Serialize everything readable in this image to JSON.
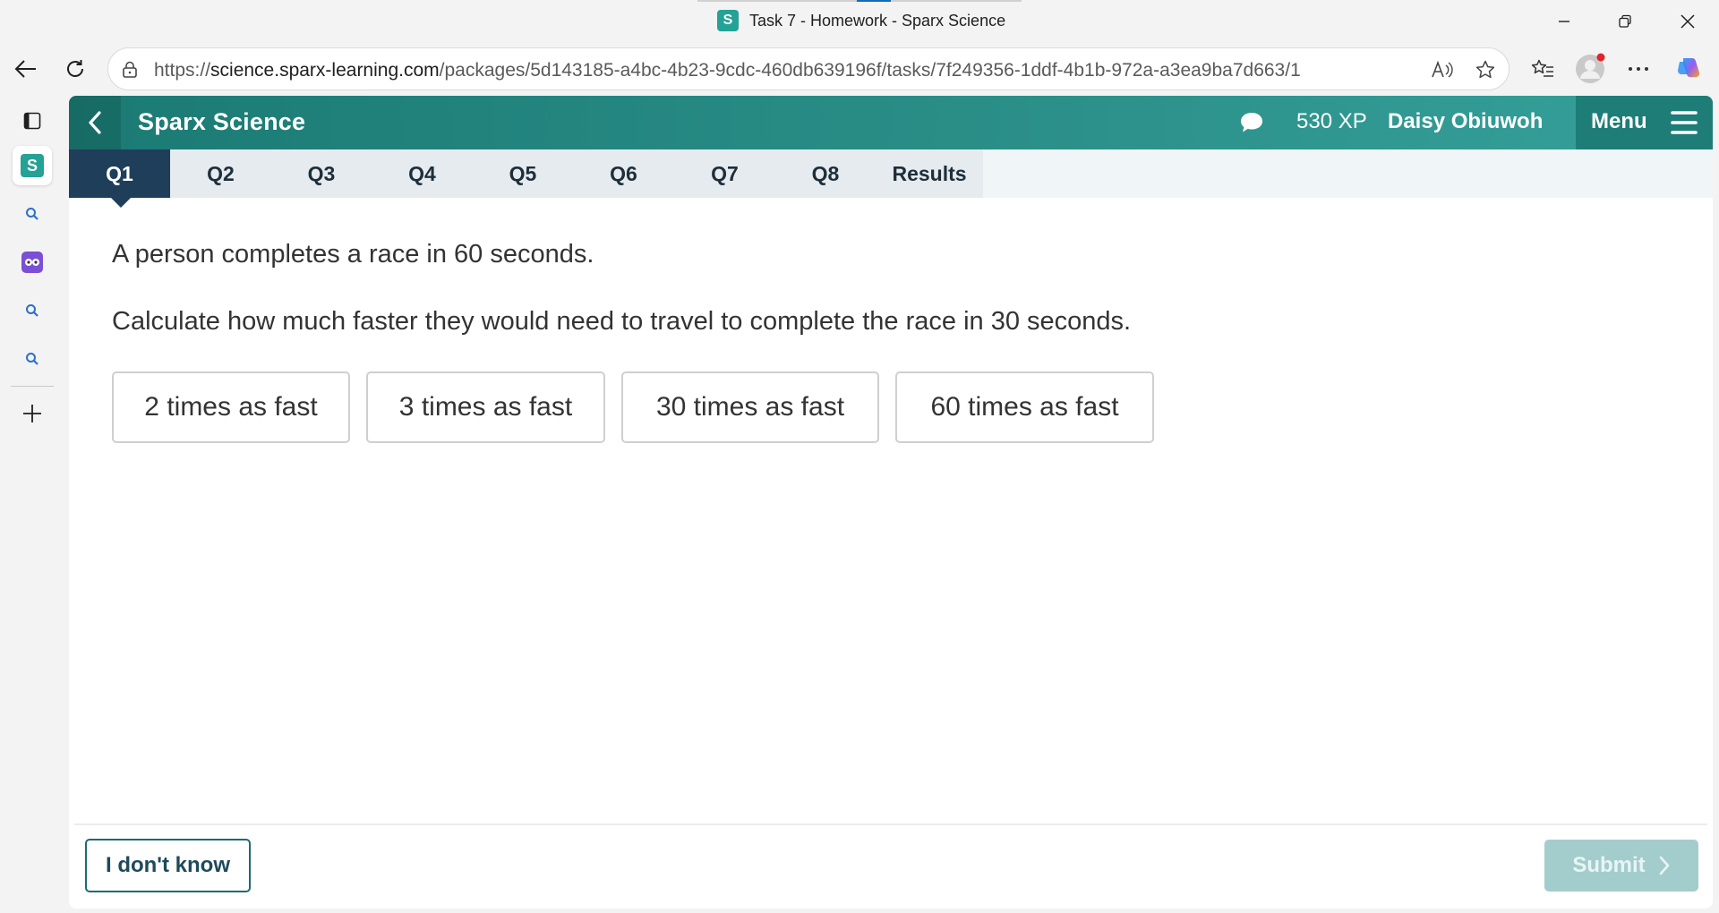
{
  "browser": {
    "tab_title": "Task 7 - Homework - Sparx Science",
    "favicon_letter": "S",
    "url_prefix": "https://",
    "url_host": "science.sparx-learning.com",
    "url_path": "/packages/5d143185-a4bc-4b23-9cdc-460db639196f/tasks/7f249356-1ddf-4b1b-972a-a3ea9ba7d663/1"
  },
  "sidebar": {
    "items": [
      {
        "icon": "tabs-icon"
      },
      {
        "icon": "sparx-app-icon",
        "letter": "S"
      },
      {
        "icon": "search-icon"
      },
      {
        "icon": "owl-app-icon"
      },
      {
        "icon": "search-icon"
      },
      {
        "icon": "search-icon"
      },
      {
        "icon": "plus-icon"
      }
    ]
  },
  "app": {
    "title": "Sparx Science",
    "xp": "530 XP",
    "user_name": "Daisy Obiuwoh",
    "menu_label": "Menu",
    "colors": {
      "header": "#2a8e87",
      "active_tab": "#1e3e5a",
      "submit_disabled": "#a3cdcc"
    }
  },
  "tabs": [
    {
      "label": "Q1",
      "active": true
    },
    {
      "label": "Q2",
      "active": false
    },
    {
      "label": "Q3",
      "active": false
    },
    {
      "label": "Q4",
      "active": false
    },
    {
      "label": "Q5",
      "active": false
    },
    {
      "label": "Q6",
      "active": false
    },
    {
      "label": "Q7",
      "active": false
    },
    {
      "label": "Q8",
      "active": false
    },
    {
      "label": "Results",
      "active": false
    }
  ],
  "question": {
    "line1": "A person completes a race in 60 seconds.",
    "line2": "Calculate how much faster they would need to travel to complete the race in 30 seconds.",
    "answers": [
      "2 times as fast",
      "3 times as fast",
      "30 times as fast",
      "60 times as fast"
    ]
  },
  "footer": {
    "dont_know": "I don't know",
    "submit": "Submit",
    "submit_enabled": false
  }
}
